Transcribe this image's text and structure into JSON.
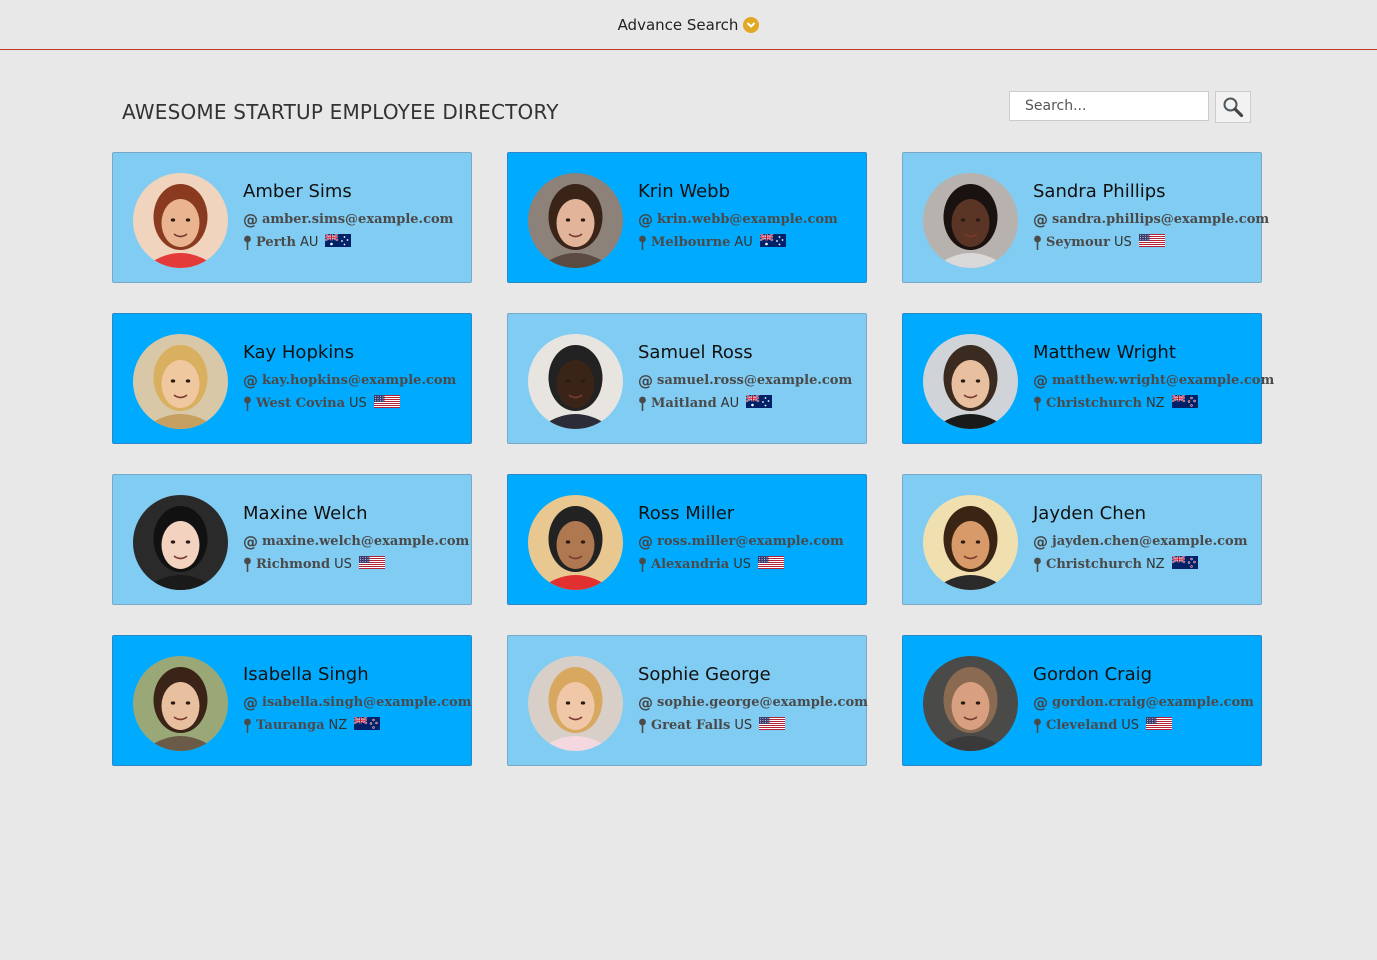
{
  "header": {
    "advance_search": "Advance Search",
    "advance_icon": "chevron-down-circle-icon"
  },
  "page": {
    "title": "AWESOME STARTUP EMPLOYEE DIRECTORY"
  },
  "search": {
    "placeholder": "Search...",
    "button_icon": "magnifier-icon"
  },
  "colors": {
    "card_light": "#81ccf2",
    "card_dark": "#00abff",
    "accent_line": "#c0392b",
    "advance_icon": "#e1a823"
  },
  "employees": [
    {
      "name": "Amber Sims",
      "email": "amber.sims@example.com",
      "city": "Perth",
      "country": "AU",
      "flag": "au",
      "style": "light",
      "skin": "#e9b48f",
      "hair": "#8a3b1f",
      "shirt": "#e33a3a",
      "bg": "#f1d4bd"
    },
    {
      "name": "Krin Webb",
      "email": "krin.webb@example.com",
      "city": "Melbourne",
      "country": "AU",
      "flag": "au",
      "style": "dark",
      "skin": "#e2b49a",
      "hair": "#3a2418",
      "shirt": "#5a4a40",
      "bg": "#8c8279"
    },
    {
      "name": "Sandra Phillips",
      "email": "sandra.phillips@example.com",
      "city": "Seymour",
      "country": "US",
      "flag": "us",
      "style": "light",
      "skin": "#5a3424",
      "hair": "#1a1210",
      "shirt": "#d9d9d9",
      "bg": "#b7b2ae"
    },
    {
      "name": "Kay Hopkins",
      "email": "kay.hopkins@example.com",
      "city": "West Covina",
      "country": "US",
      "flag": "us",
      "style": "dark",
      "skin": "#f0c8a0",
      "hair": "#d9b060",
      "shirt": "#c5a060",
      "bg": "#d8c8a8"
    },
    {
      "name": "Samuel Ross",
      "email": "samuel.ross@example.com",
      "city": "Maitland",
      "country": "AU",
      "flag": "au",
      "style": "light",
      "skin": "#3a2418",
      "hair": "#222",
      "shirt": "#2c2c38",
      "bg": "#e8e4e0"
    },
    {
      "name": "Matthew Wright",
      "email": "matthew.wright@example.com",
      "city": "Christchurch",
      "country": "NZ",
      "flag": "nz",
      "style": "dark",
      "skin": "#e8c0a0",
      "hair": "#3a2a20",
      "shirt": "#1a1a1a",
      "bg": "#d0d4d8"
    },
    {
      "name": "Maxine Welch",
      "email": "maxine.welch@example.com",
      "city": "Richmond",
      "country": "US",
      "flag": "us",
      "style": "light",
      "skin": "#f3d2c0",
      "hair": "#111",
      "shirt": "#1a1a1a",
      "bg": "#2a2a2a"
    },
    {
      "name": "Ross Miller",
      "email": "ross.miller@example.com",
      "city": "Alexandria",
      "country": "US",
      "flag": "us",
      "style": "dark",
      "skin": "#b07850",
      "hair": "#222",
      "shirt": "#e03030",
      "bg": "#e8c890"
    },
    {
      "name": "Jayden Chen",
      "email": "jayden.chen@example.com",
      "city": "Christchurch",
      "country": "NZ",
      "flag": "nz",
      "style": "light",
      "skin": "#d89a68",
      "hair": "#3a2414",
      "shirt": "#2a2a2a",
      "bg": "#f0e0b0"
    },
    {
      "name": "Isabella Singh",
      "email": "isabella.singh@example.com",
      "city": "Tauranga",
      "country": "NZ",
      "flag": "nz",
      "style": "dark",
      "skin": "#e8c0a0",
      "hair": "#3a2418",
      "shirt": "#6a5a48",
      "bg": "#9aa878"
    },
    {
      "name": "Sophie George",
      "email": "sophie.george@example.com",
      "city": "Great Falls",
      "country": "US",
      "flag": "us",
      "style": "light",
      "skin": "#f0c8a8",
      "hair": "#d8a860",
      "shirt": "#f4d8e0",
      "bg": "#d8d0c8"
    },
    {
      "name": "Gordon Craig",
      "email": "gordon.craig@example.com",
      "city": "Cleveland",
      "country": "US",
      "flag": "us",
      "style": "dark",
      "skin": "#d8a080",
      "hair": "#8a6a50",
      "shirt": "#3a3a3a",
      "bg": "#4a4a48"
    }
  ]
}
